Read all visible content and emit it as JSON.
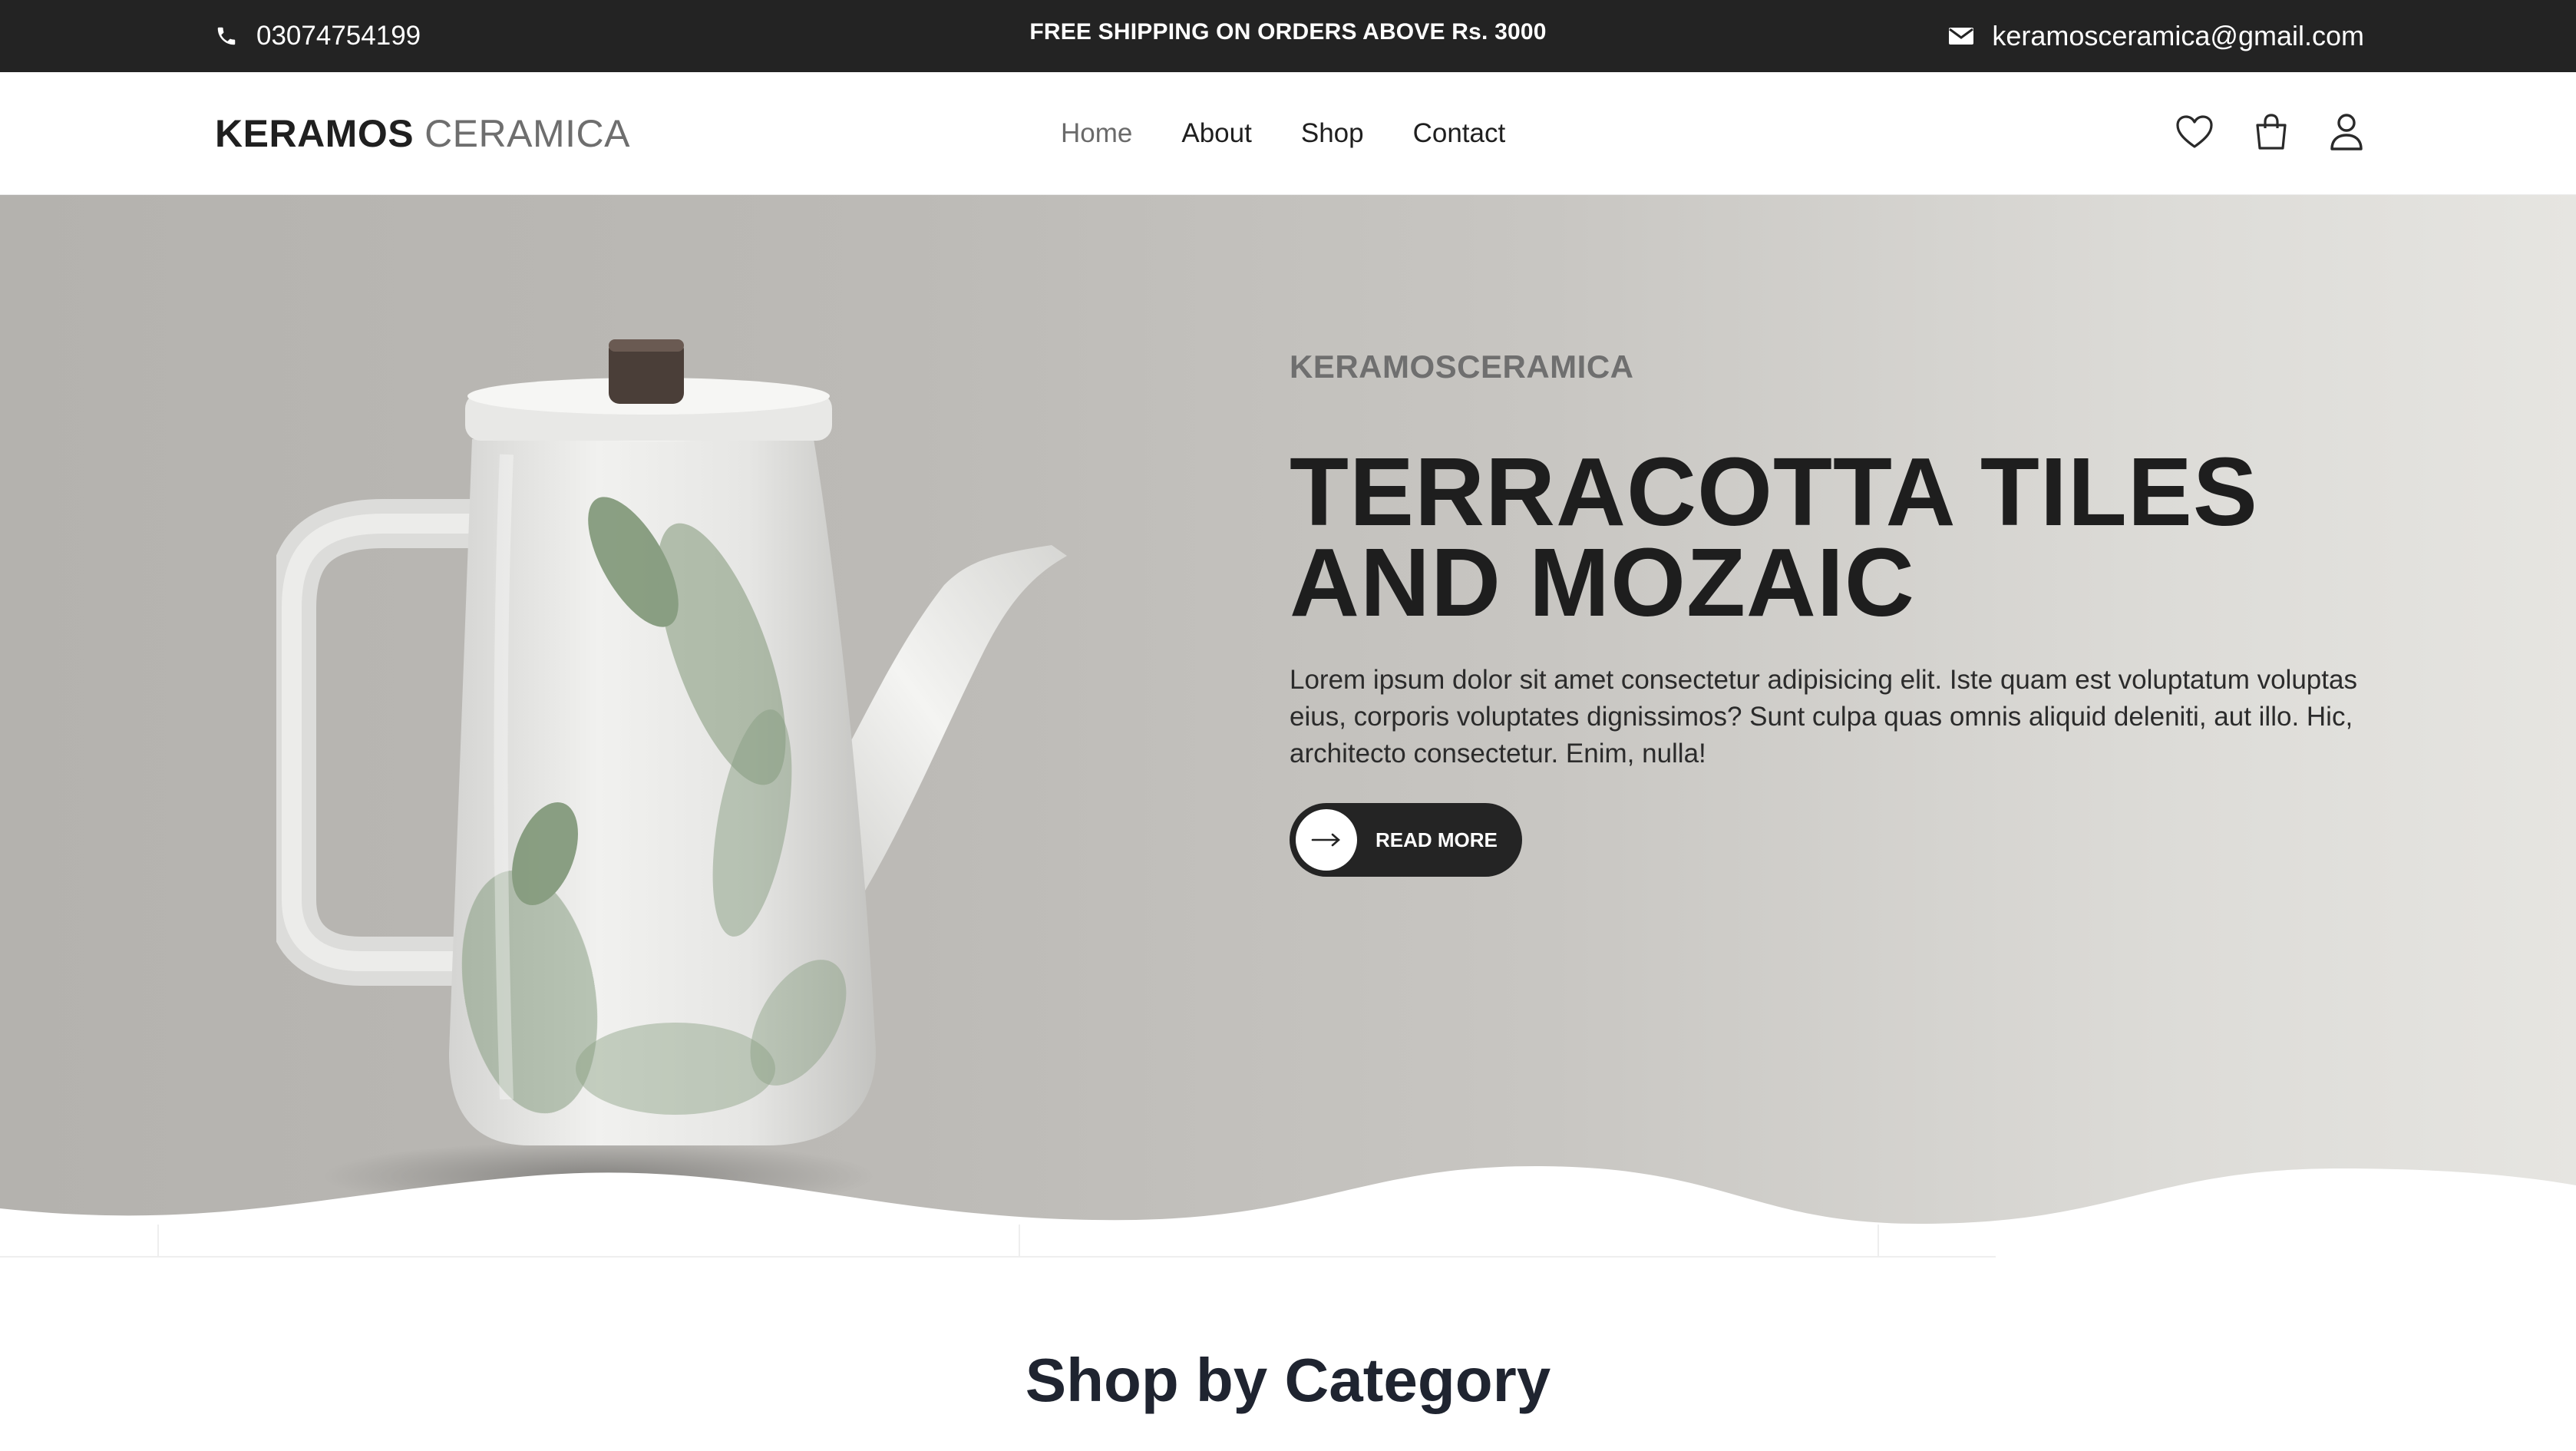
{
  "topbar": {
    "phone": "03074754199",
    "promo": "FREE SHIPPING ON ORDERS ABOVE Rs. 3000",
    "email": "keramosceramica@gmail.com",
    "icons": {
      "phone": "phone-icon",
      "email": "envelope-icon"
    }
  },
  "header": {
    "logo_part1": "KERAMOS",
    "logo_part2": "CERAMICA",
    "nav": [
      {
        "label": "Home",
        "active": true
      },
      {
        "label": "About",
        "active": false
      },
      {
        "label": "Shop",
        "active": false
      },
      {
        "label": "Contact",
        "active": false
      }
    ],
    "icons": [
      "heart-icon",
      "shopping-bag-icon",
      "user-icon"
    ]
  },
  "hero": {
    "eyebrow": "KERAMOSCERAMICA",
    "title": "TERRACOTTA TILES AND MOZAIC",
    "body": "Lorem ipsum dolor sit amet consectetur adipisicing elit. Iste quam est voluptatum voluptas eius, corporis voluptates dignissimos? Sunt culpa quas omnis aliquid deleniti, aut illo. Hic, architecto consectetur. Enim, nulla!",
    "button_label": "READ MORE",
    "button_icon": "arrow-right-icon"
  },
  "section": {
    "title": "Shop by Category"
  },
  "colors": {
    "topbar_bg": "#232323",
    "hero_bg_left": "#b4b2ae",
    "hero_bg_right": "#e6e5e1",
    "button_bg": "#242424",
    "heading": "#1e1e1e"
  }
}
